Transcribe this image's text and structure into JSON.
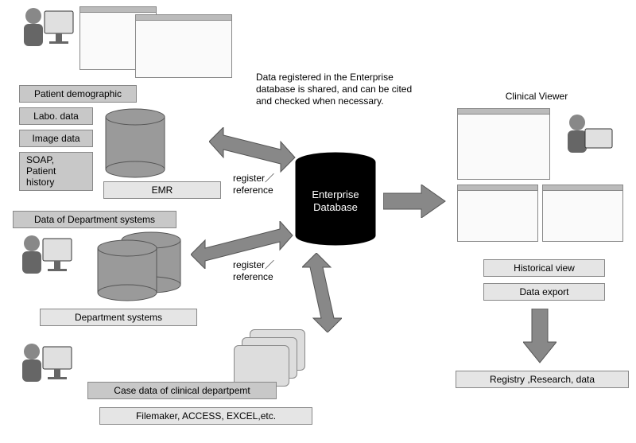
{
  "left": {
    "patient_demo": "Patient demographic",
    "labo": "Labo. data",
    "image": "Image data",
    "soap": "SOAP,\nPatient\nhistory",
    "emr": "EMR",
    "dept_data": "Data of Department systems",
    "dept_systems": "Department systems",
    "case_data": "Case data of clinical departpemt",
    "filemaker": "Filemaker, ACCESS, EXCEL,etc."
  },
  "center": {
    "note": "Data registered in the Enterprise database is shared, and can be cited and checked when necessary.",
    "db_label1": "Enterprise",
    "db_label2": "Database",
    "regref1": "register／\nreference",
    "regref2": "register／\nreference"
  },
  "right": {
    "title": "Clinical Viewer",
    "historical": "Historical view",
    "export": "Data export",
    "registry": "Registry ,Research, data"
  }
}
